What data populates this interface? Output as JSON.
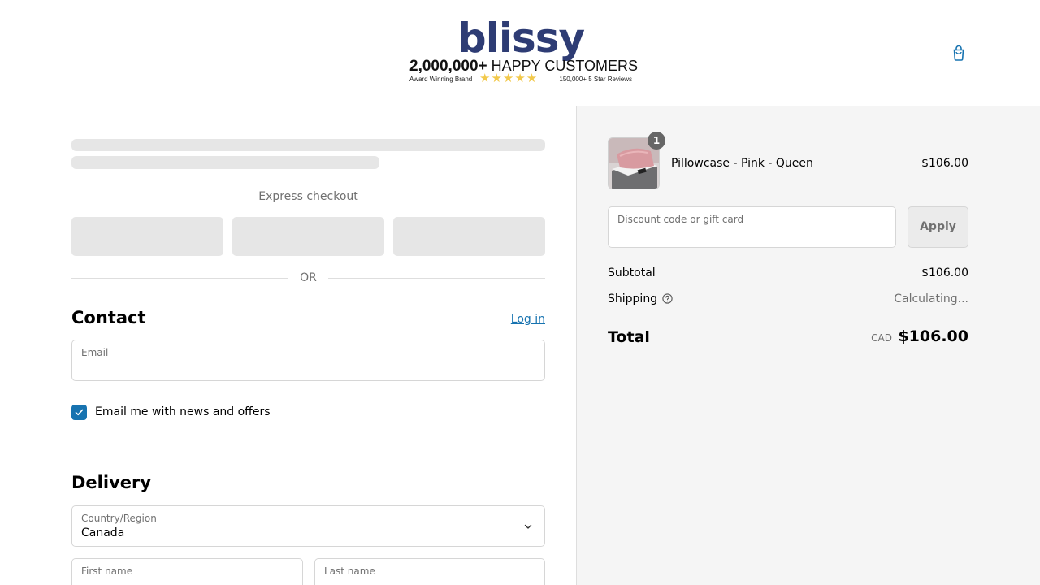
{
  "header": {
    "brand": {
      "name": "blissy",
      "customers_count": "2,000,000+",
      "customers_text": "HAPPY CUSTOMERS",
      "award_text": "Award Winning Brand",
      "stars": "★★★★★",
      "reviews_text": "150,000+ 5 Star Reviews"
    },
    "cart_icon": "shopping-bag-icon"
  },
  "checkout": {
    "express_label": "Express checkout",
    "or_label": "OR",
    "contact": {
      "title": "Contact",
      "login_label": "Log in",
      "email_label": "Email",
      "email_value": "",
      "newsletter_label": "Email me with news and offers",
      "newsletter_checked": true
    },
    "delivery": {
      "title": "Delivery",
      "country_label": "Country/Region",
      "country_value": "Canada",
      "first_name_label": "First name",
      "last_name_label": "Last name"
    }
  },
  "summary": {
    "item": {
      "name": "Pillowcase - Pink - Queen",
      "price": "$106.00",
      "quantity": "1"
    },
    "discount_placeholder": "Discount code or gift card",
    "apply_label": "Apply",
    "subtotal_label": "Subtotal",
    "subtotal_value": "$106.00",
    "shipping_label": "Shipping",
    "shipping_value": "Calculating...",
    "total_label": "Total",
    "total_currency": "CAD",
    "total_value": "$106.00"
  },
  "colors": {
    "brand": "#2e3c74",
    "link": "#1773b0",
    "summary_bg": "#f5f5f5",
    "skeleton": "#e6e6e6"
  }
}
